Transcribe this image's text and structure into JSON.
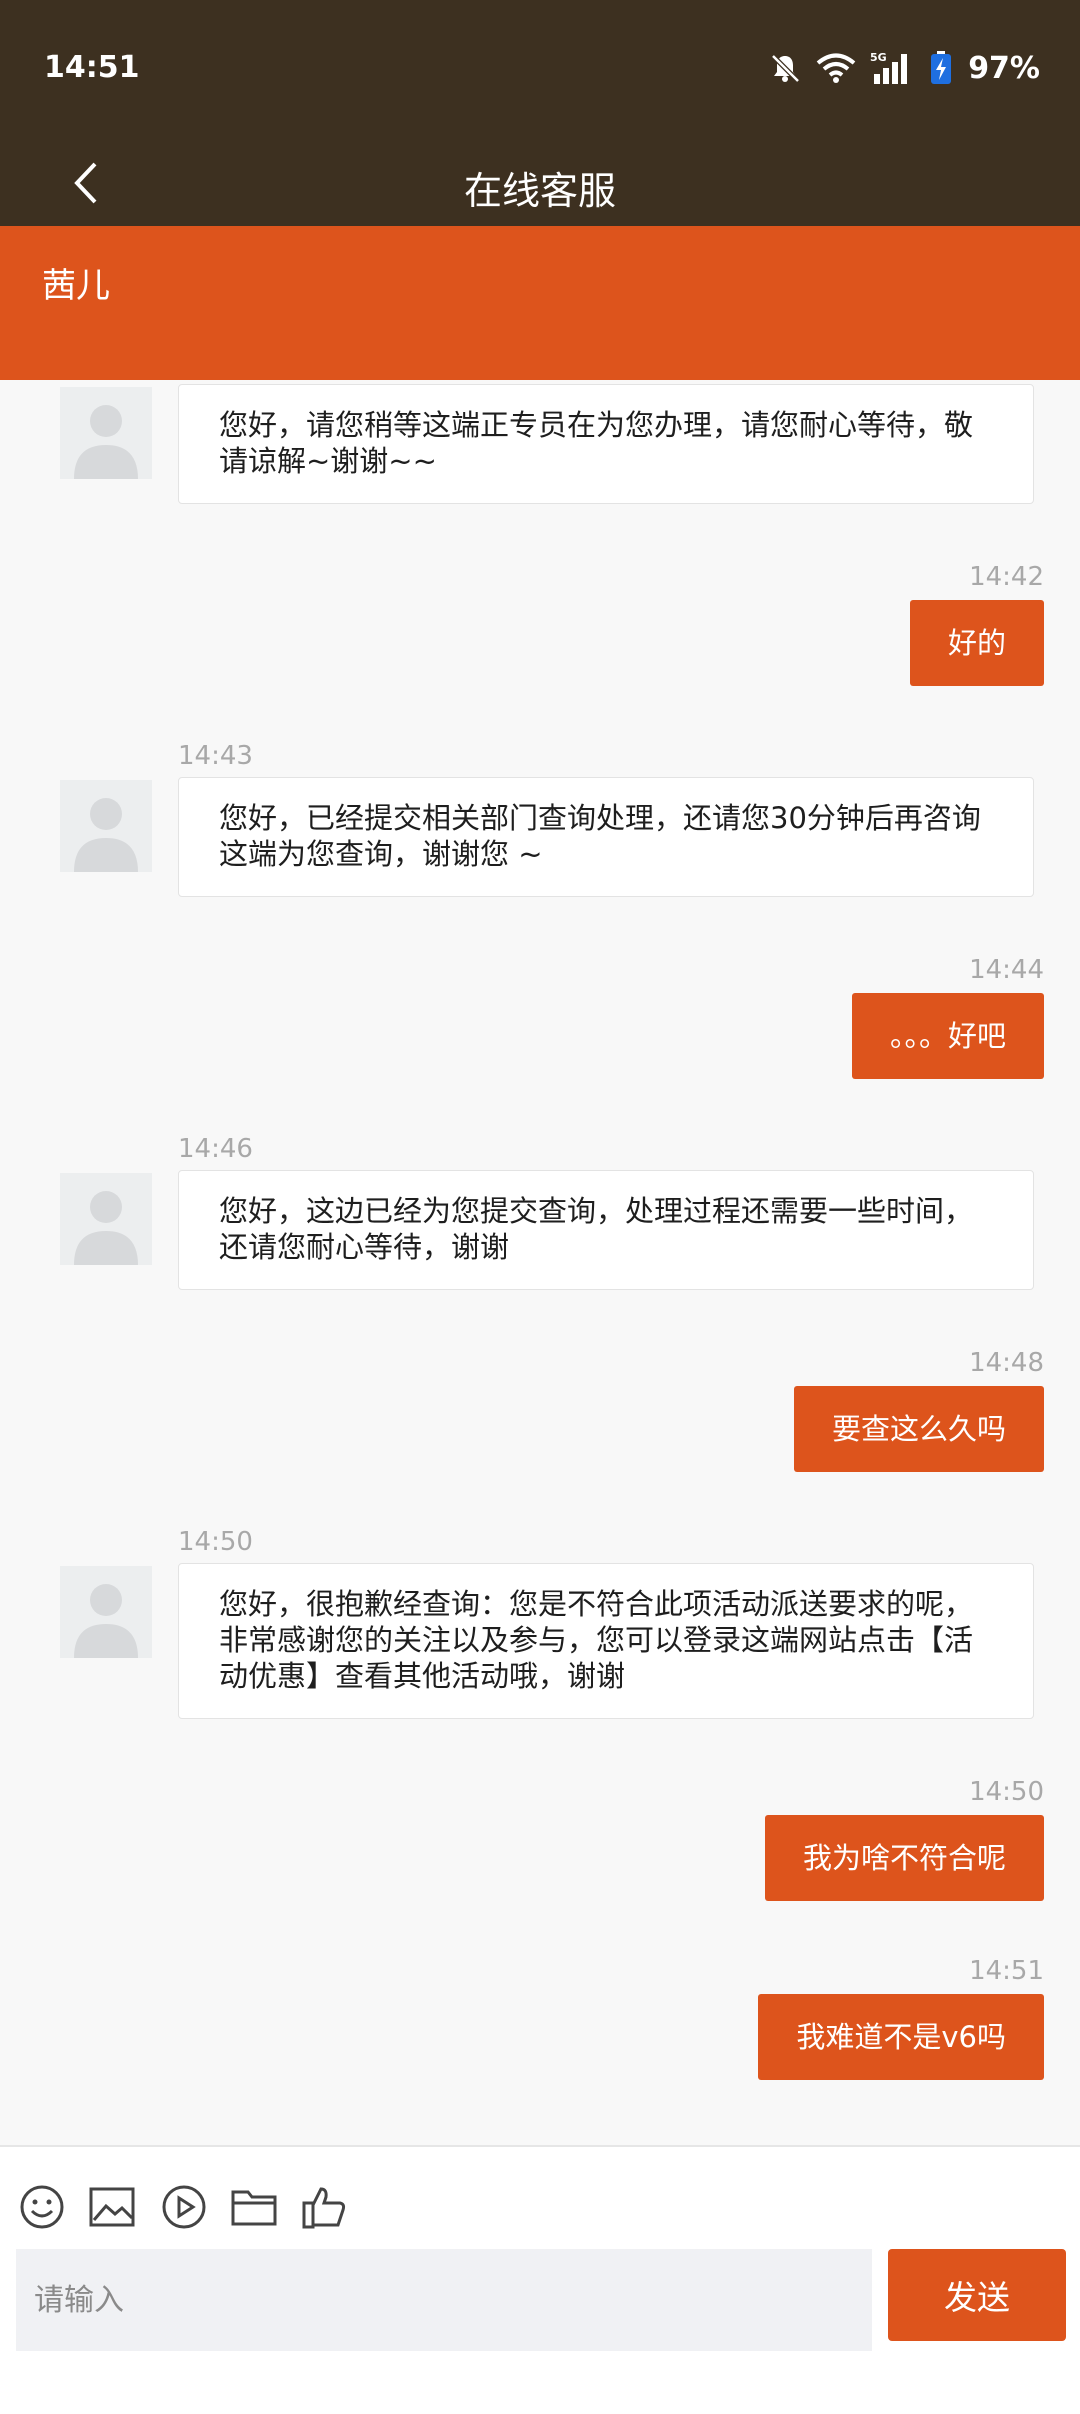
{
  "status_bar": {
    "time": "14:51",
    "battery": "97%"
  },
  "header": {
    "title": "在线客服"
  },
  "agent": {
    "name": "茜儿"
  },
  "messages": [
    {
      "from": "agent",
      "time": "",
      "text": "您好，请您稍等这端正专员在为您办理，请您耐心等待，敬请谅解~谢谢~~"
    },
    {
      "from": "user",
      "time": "14:42",
      "text": "好的"
    },
    {
      "from": "agent",
      "time": "14:43",
      "text": "您好，已经提交相关部门查询处理，还请您30分钟后再咨询这端为您查询，谢谢您 ~"
    },
    {
      "from": "user",
      "time": "14:44",
      "text": "。。。好吧"
    },
    {
      "from": "agent",
      "time": "14:46",
      "text": "您好，这边已经为您提交查询，处理过程还需要一些时间，还请您耐心等待，谢谢"
    },
    {
      "from": "user",
      "time": "14:48",
      "text": "要查这么久吗"
    },
    {
      "from": "agent",
      "time": "14:50",
      "text": "您好，很抱歉经查询：您是不符合此项活动派送要求的呢，非常感谢您的关注以及参与，您可以登录这端网站点击【活动优惠】查看其他活动哦，谢谢"
    },
    {
      "from": "user",
      "time": "14:50",
      "text": "我为啥不符合呢"
    },
    {
      "from": "user",
      "time": "14:51",
      "text": "我难道不是v6吗"
    }
  ],
  "input": {
    "placeholder": "请输入",
    "value": ""
  },
  "send_label": "发送",
  "toolbar_icons": [
    "emoji-icon",
    "image-icon",
    "video-icon",
    "folder-icon",
    "thumbs-up-icon"
  ],
  "colors": {
    "accent": "#dd541c",
    "header_bg": "#3d3020",
    "bubble_in_bg": "#ffffff",
    "chat_bg": "#f8f8f8"
  }
}
